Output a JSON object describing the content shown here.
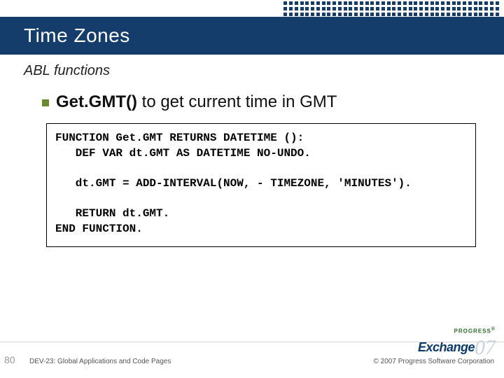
{
  "title": "Time Zones",
  "subtitle": "ABL functions",
  "bullet": {
    "strong": "Get.GMT()",
    "rest": " to get current time in GMT"
  },
  "code": "FUNCTION Get.GMT RETURNS DATETIME ():\n   DEF VAR dt.GMT AS DATETIME NO-UNDO.\n\n   dt.GMT = ADD-INTERVAL(NOW, - TIMEZONE, 'MINUTES').\n\n   RETURN dt.GMT.\nEND FUNCTION.",
  "footer": {
    "page": "80",
    "left": "DEV-23: Global Applications and Code Pages",
    "right": "© 2007 Progress Software Corporation"
  },
  "logo": {
    "top": "PROGRESS",
    "main": "Exchange",
    "year": "07",
    "reg": "®"
  }
}
